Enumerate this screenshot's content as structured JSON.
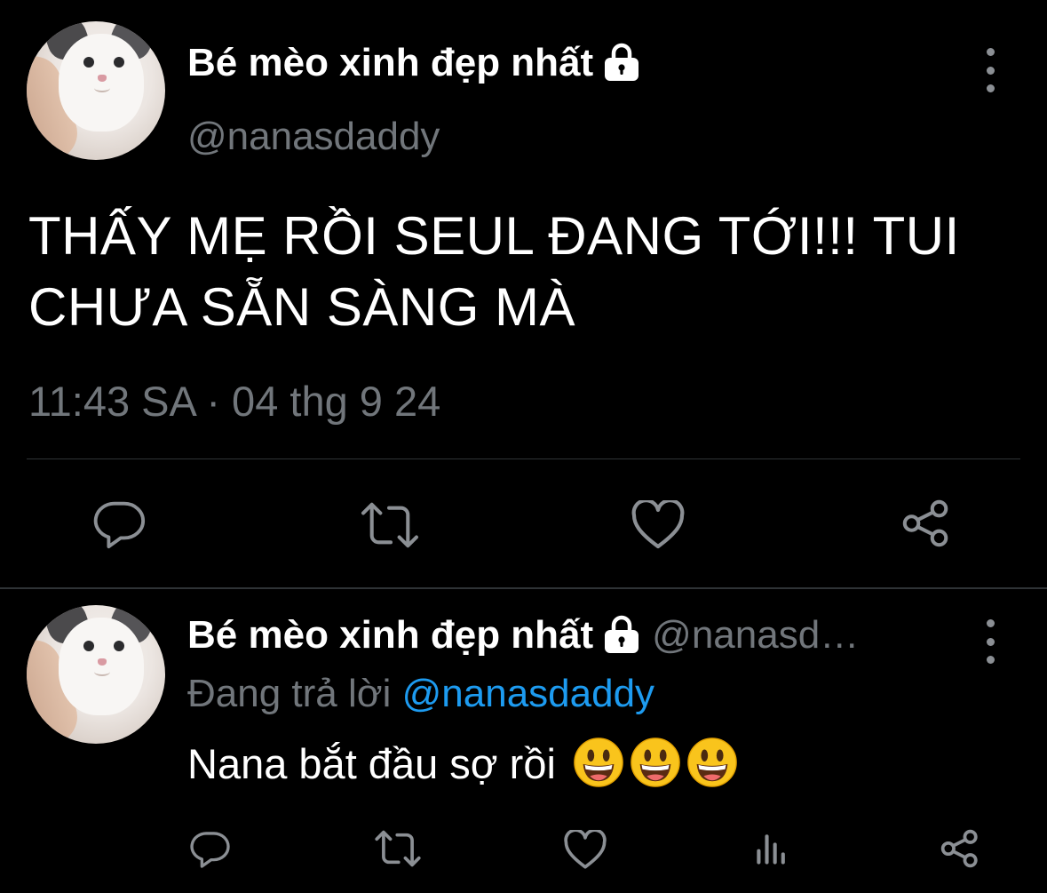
{
  "main_tweet": {
    "display_name": "Bé mèo xinh đẹp nhất",
    "handle": "@nanasdaddy",
    "text": "THẤY MẸ RỒI SEUL ĐANG TỚI!!! TUI CHƯA SẴN SÀNG MÀ",
    "timestamp": "11:43 SA · 04 thg 9 24",
    "actions": [
      "reply-icon",
      "retweet-icon",
      "like-icon",
      "share-icon"
    ]
  },
  "reply_tweet": {
    "display_name": "Bé mèo xinh đẹp nhất",
    "handle": "@nanasd…",
    "replying_prefix": "Đang trả lời",
    "replying_to": "@nanasdaddy",
    "text": "Nana bắt đầu sợ rồi",
    "emojis": [
      "grinning-face-icon",
      "grinning-face-icon",
      "grinning-face-icon"
    ],
    "actions": [
      "reply-icon",
      "retweet-icon",
      "like-icon",
      "views-icon",
      "share-icon"
    ]
  },
  "colors": {
    "background": "#000000",
    "primary_text": "#ffffff",
    "secondary_text": "#71767b",
    "link": "#1d9bf0",
    "icon": "#8b8f94",
    "divider": "#2f3336"
  }
}
